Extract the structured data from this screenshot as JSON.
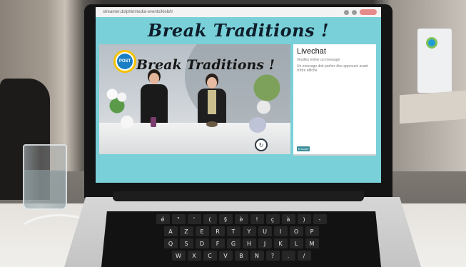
{
  "browser": {
    "address": "streamer.dolphinmedia-events/kleb/tr",
    "action_label": "DÉMARRER"
  },
  "page": {
    "title": "Break Traditions !"
  },
  "video": {
    "logo_text": "POST",
    "overlay_title": "Break Traditions !"
  },
  "livechat": {
    "title": "Livechat",
    "messages": [
      "Veuillez entrer un message",
      "Un message doit parfois être approuvé avant d'être affiché"
    ],
    "send_label": "Envoyer"
  },
  "keyboard": {
    "rows": [
      [
        "é",
        "\"",
        "'",
        "(",
        "§",
        "è",
        "!",
        "ç",
        "à",
        ")",
        "-"
      ],
      [
        "A",
        "Z",
        "E",
        "R",
        "T",
        "Y",
        "U",
        "I",
        "O",
        "P"
      ],
      [
        "Q",
        "S",
        "D",
        "F",
        "G",
        "H",
        "J",
        "K",
        "L",
        "M"
      ],
      [
        "W",
        "X",
        "C",
        "V",
        "B",
        "N",
        "?",
        ".",
        "/"
      ]
    ]
  }
}
